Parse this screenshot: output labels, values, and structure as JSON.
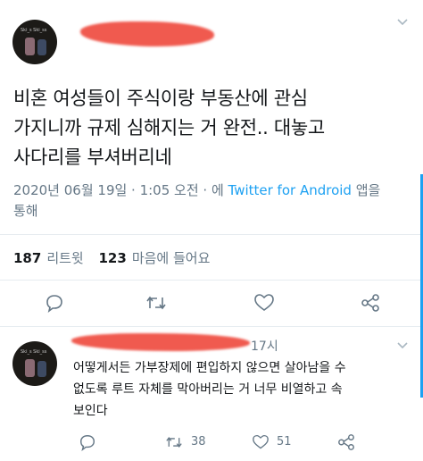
{
  "tweet": {
    "text_lines": [
      "비혼 여성들이 주식이랑 부동산에 관심",
      "가지니까 규제 심해지는 거 완전.. 대놓고",
      "사다리를 부셔버리네"
    ],
    "date": "2020년 06월 19일 · 1:05 오전 · 에 ",
    "source": "Twitter for Android",
    "source_suffix": " 앱을",
    "meta_line2": "통해",
    "retweet_count": "187",
    "retweet_label": "리트윗",
    "like_count": "123",
    "like_label": "마음에 들어요"
  },
  "reply": {
    "time": "17시",
    "text_lines": [
      "어떻게서든 가부장제에 편입하지 않으면 살아남을 수",
      "없도록 루트 자체를 막아버리는 거 너무 비열하고 속",
      "보인다"
    ],
    "retweets": "38",
    "likes": "51"
  },
  "avatar_tag": "Ski_s  Ski_ss",
  "colors": {
    "accent": "#1da1f2",
    "muted": "#657786",
    "redaction": "#f05a4f"
  }
}
